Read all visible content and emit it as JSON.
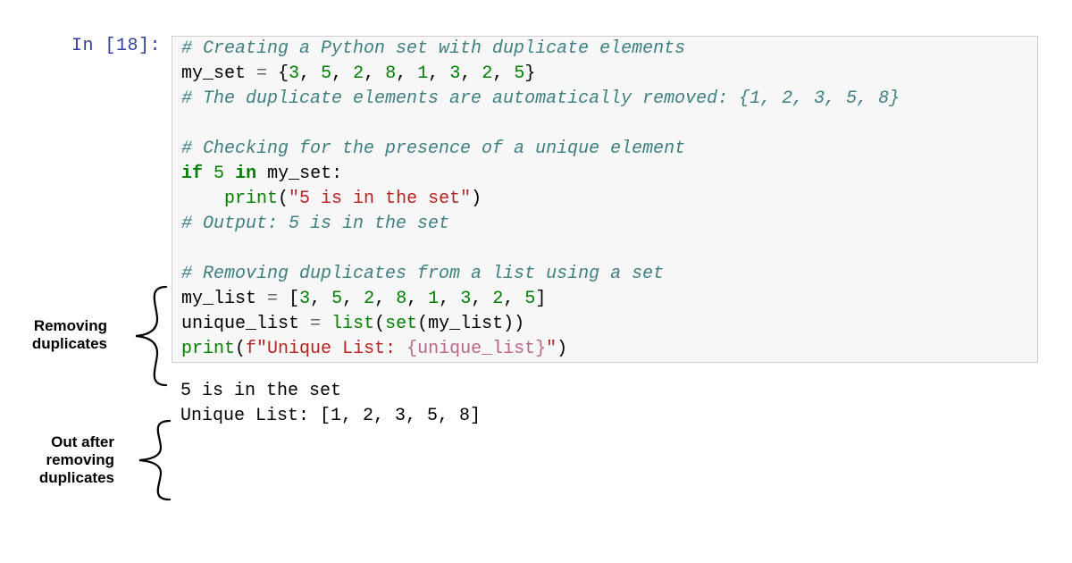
{
  "prompt": {
    "in_label": "In [18]:"
  },
  "code": {
    "l1_comment": "# Creating a Python set with duplicate elements",
    "l2_var": "my_set",
    "l2_vals": [
      "3",
      "5",
      "2",
      "8",
      "1",
      "3",
      "2",
      "5"
    ],
    "l3_comment": "# The duplicate elements are automatically removed: {1, 2, 3, 5, 8}",
    "l5_comment": "# Checking for the presence of a unique element",
    "l6_if": "if",
    "l6_val": "5",
    "l6_in": "in",
    "l6_var": "my_set",
    "l7_print": "print",
    "l7_str": "\"5 is in the set\"",
    "l8_comment": "# Output: 5 is in the set",
    "l10_comment": "# Removing duplicates from a list using a set",
    "l11_var": "my_list",
    "l11_vals": [
      "3",
      "5",
      "2",
      "8",
      "1",
      "3",
      "2",
      "5"
    ],
    "l12_var": "unique_list",
    "l12_list": "list",
    "l12_set": "set",
    "l12_arg": "my_list",
    "l13_print": "print",
    "l13_f": "f",
    "l13_s1": "\"Unique List: ",
    "l13_si": "{unique_list}",
    "l13_s2": "\""
  },
  "output": {
    "line1": "5 is in the set",
    "line2": "Unique List: [1, 2, 3, 5, 8]"
  },
  "annotations": {
    "removing": "Removing\nduplicates",
    "out_after": "Out after\nremoving\nduplicates"
  }
}
